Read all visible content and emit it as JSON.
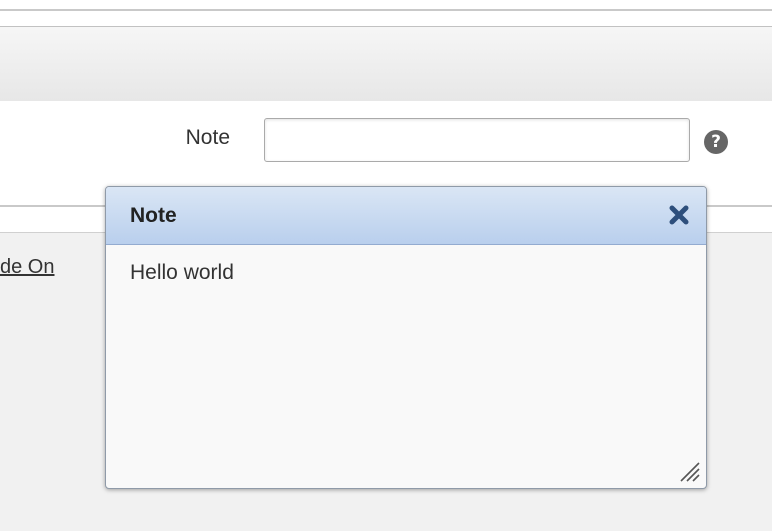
{
  "form": {
    "note_label": "Note",
    "note_value": "",
    "note_placeholder": "",
    "help_symbol": "?"
  },
  "side_link": {
    "text": "de On"
  },
  "dialog": {
    "title": "Note",
    "body_text": "Hello world",
    "close_icon": "close-icon",
    "resize_icon": "resize-grip-icon"
  },
  "colors": {
    "titlebar_top": "#dae6f5",
    "titlebar_bottom": "#b9cfed",
    "close_icon": "#2e4f7c",
    "help_icon_bg": "#666666",
    "content_bg": "#f1f1f1"
  }
}
